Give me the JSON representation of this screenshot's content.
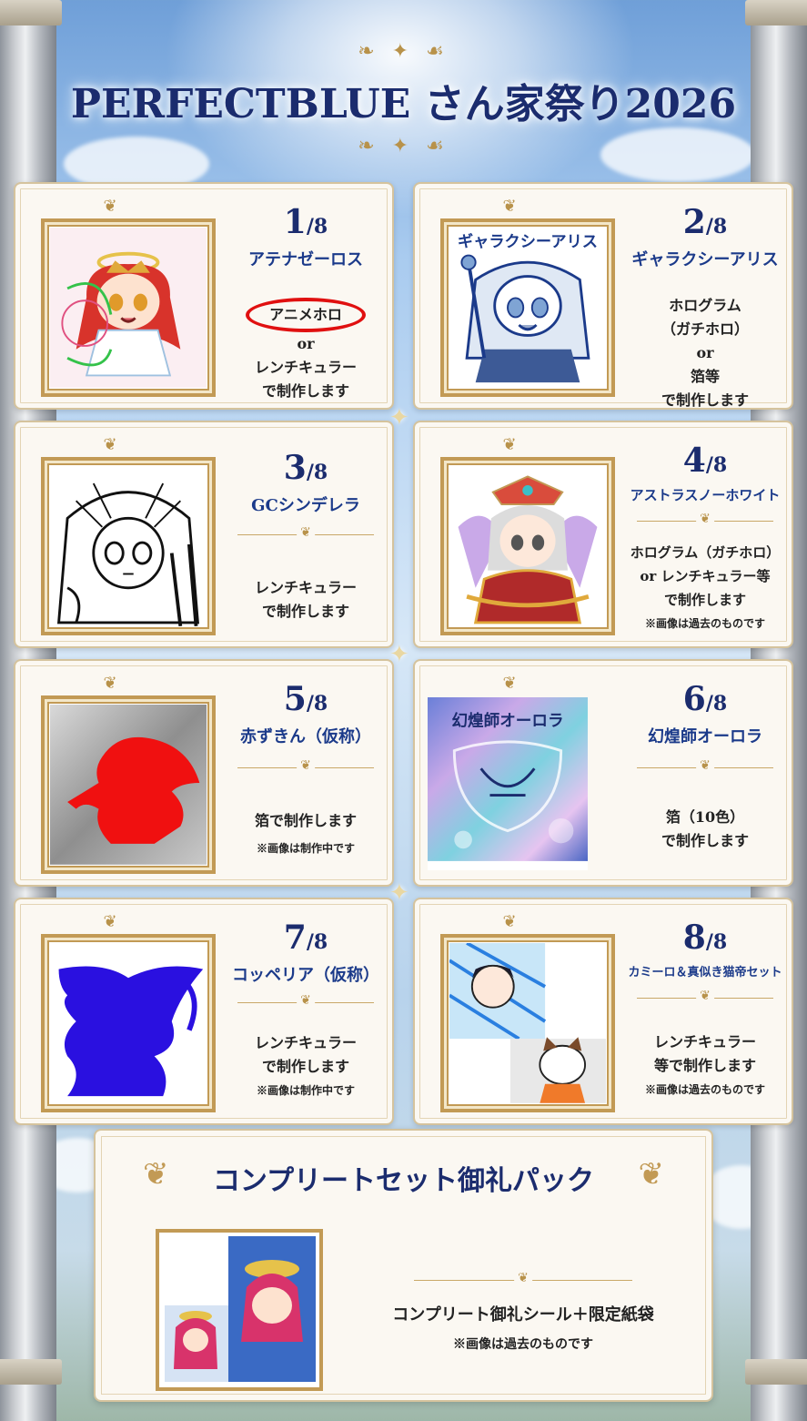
{
  "header": {
    "title": "PERFECTBLUE さん家祭り2026"
  },
  "items": [
    {
      "num": "1",
      "den": "/8",
      "name": "アテナゼーロス",
      "circled": "アニメホロ",
      "lines": [
        "or",
        "レンチキュラー",
        "で制作します"
      ],
      "note": ""
    },
    {
      "num": "2",
      "den": "/8",
      "name": "ギャラクシーアリス",
      "lines": [
        "ホログラム",
        "（ガチホロ）",
        "or",
        "箔等",
        "で制作します"
      ],
      "note": ""
    },
    {
      "num": "3",
      "den": "/8",
      "name": "GCシンデレラ",
      "lines": [
        "レンチキュラー",
        "で制作します"
      ],
      "note": ""
    },
    {
      "num": "4",
      "den": "/8",
      "name": "アストラスノーホワイト",
      "lines": [
        "ホログラム（ガチホロ）",
        "or レンチキュラー等",
        "で制作します"
      ],
      "note": "※画像は過去のものです"
    },
    {
      "num": "5",
      "den": "/8",
      "name": "赤ずきん（仮称）",
      "lines": [
        "箔で制作します"
      ],
      "note": "※画像は制作中です"
    },
    {
      "num": "6",
      "den": "/8",
      "name": "幻煌師オーロラ",
      "lines": [
        "箔（10色）",
        "で制作します"
      ],
      "note": ""
    },
    {
      "num": "7",
      "den": "/8",
      "name": "コッペリア（仮称）",
      "lines": [
        "レンチキュラー",
        "で制作します"
      ],
      "note": "※画像は制作中です"
    },
    {
      "num": "8",
      "den": "/8",
      "name": "カミーロ＆真似き猫帝セット",
      "lines": [
        "レンチキュラー",
        "等で制作します"
      ],
      "note": "※画像は過去のものです"
    }
  ],
  "complete": {
    "title": "コンプリートセット御礼パック",
    "desc": "コンプリート御礼シール＋限定紙袋",
    "note": "※画像は過去のものです"
  },
  "art": {
    "sticker2_banner": "ギャラクシーアリス",
    "sticker6_banner": "幻煌師オーロラ"
  },
  "colors": {
    "navy": "#1b2c6e",
    "gold": "#c29a55",
    "red_mark": "#e01010",
    "silhouette_red": "#f01010",
    "silhouette_blue": "#2a10e0"
  }
}
